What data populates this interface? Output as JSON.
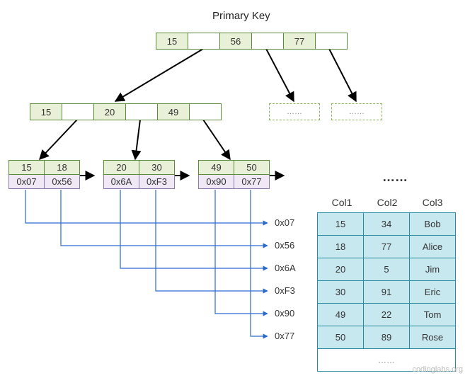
{
  "title": "Primary Key",
  "root": {
    "keys": [
      "15",
      "56",
      "77"
    ]
  },
  "internal": {
    "keys": [
      "15",
      "20",
      "49"
    ]
  },
  "ghosts": [
    "……",
    "……"
  ],
  "leaves": [
    {
      "keys": [
        "15",
        "18"
      ],
      "ptrs": [
        "0x07",
        "0x56"
      ]
    },
    {
      "keys": [
        "20",
        "30"
      ],
      "ptrs": [
        "0x6A",
        "0xF3"
      ]
    },
    {
      "keys": [
        "49",
        "50"
      ],
      "ptrs": [
        "0x90",
        "0x77"
      ]
    }
  ],
  "leaf_ellipsis": "……",
  "addresses": [
    "0x07",
    "0x56",
    "0x6A",
    "0xF3",
    "0x90",
    "0x77"
  ],
  "columns": [
    "Col1",
    "Col2",
    "Col3"
  ],
  "table": [
    [
      "15",
      "34",
      "Bob"
    ],
    [
      "18",
      "77",
      "Alice"
    ],
    [
      "20",
      "5",
      "Jim"
    ],
    [
      "30",
      "91",
      "Eric"
    ],
    [
      "49",
      "22",
      "Tom"
    ],
    [
      "50",
      "89",
      "Rose"
    ]
  ],
  "table_footer": "……",
  "watermark": "codinglabs.org"
}
